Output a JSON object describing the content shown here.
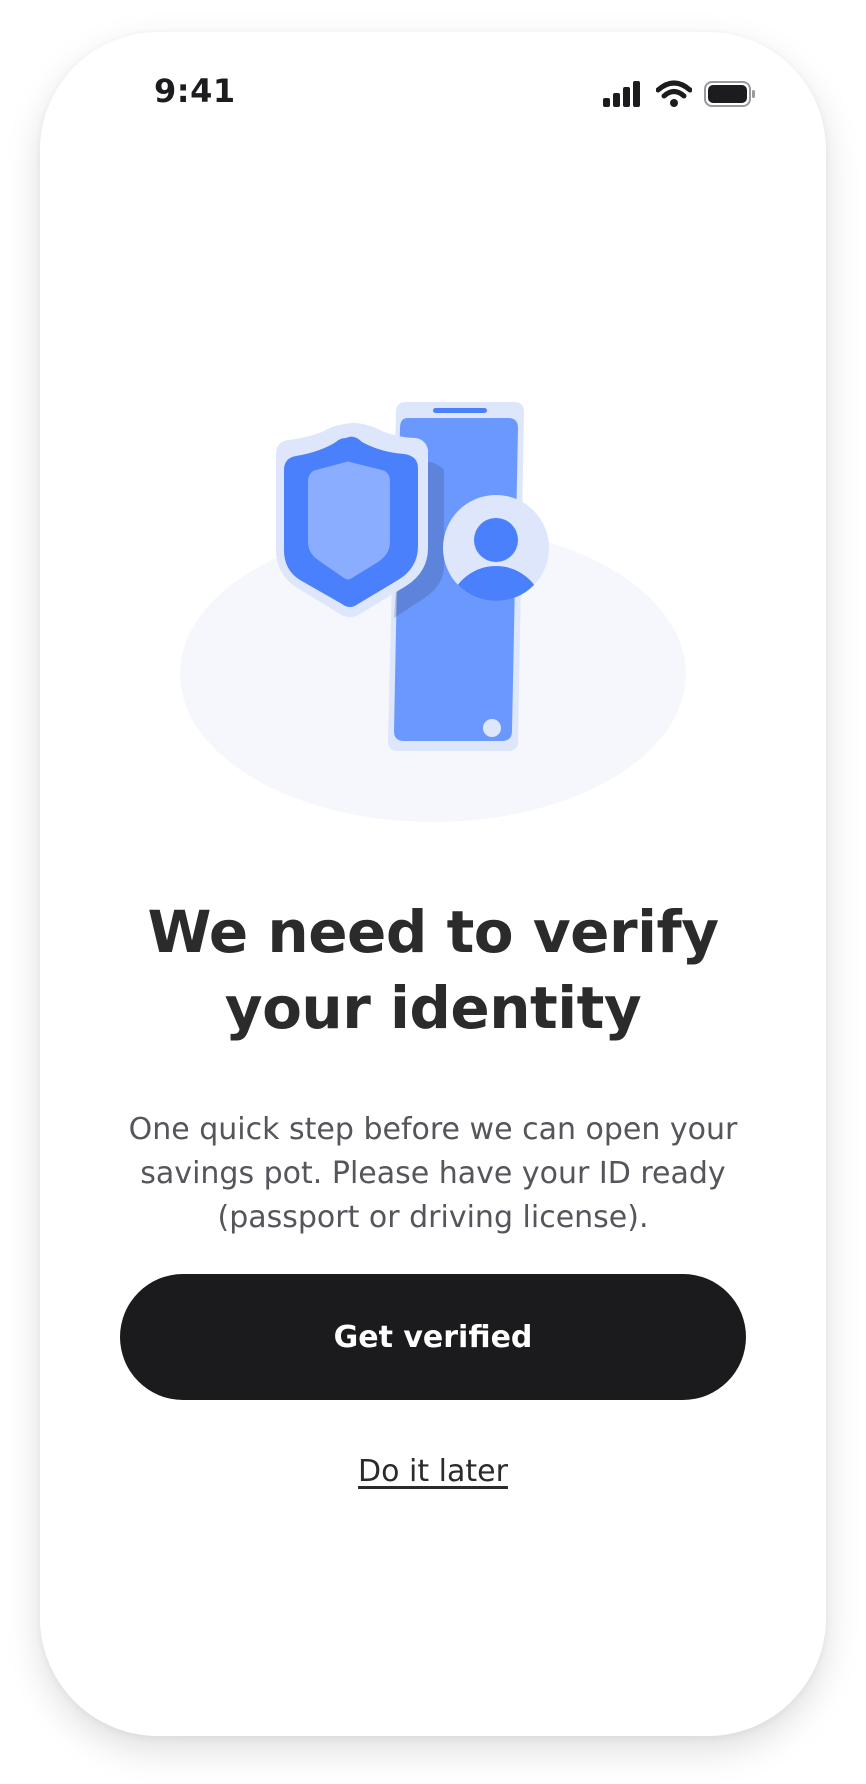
{
  "status_bar": {
    "time": "9:41",
    "icons": [
      "cellular-signal-icon",
      "wifi-icon",
      "battery-icon"
    ]
  },
  "illustration": {
    "icons": [
      "shield-icon",
      "phone-icon",
      "user-avatar-icon"
    ],
    "colors": {
      "backdrop": "#f5f7fc",
      "phone_outer": "#dde6fb",
      "phone_screen": "#6b98fd",
      "accent_blue": "#4a80fc",
      "shield_inner": "#8aadff"
    }
  },
  "verification": {
    "title": "We need to verify your identity",
    "description": "One quick step before we can open your savings pot. Please have your ID ready (passport or driving license).",
    "primary_button_label": "Get verified",
    "secondary_link_label": "Do it later"
  },
  "colors": {
    "primary_button_bg": "#1b1b1d",
    "title_text": "#2b2b2b",
    "body_text": "#55555b"
  }
}
